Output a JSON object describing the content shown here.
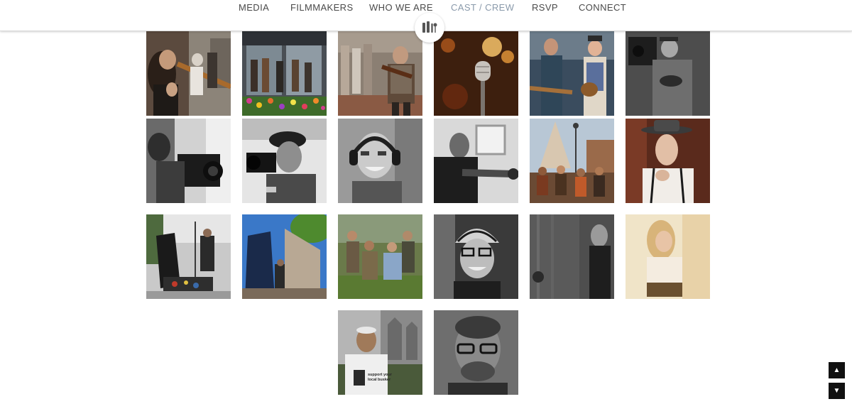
{
  "nav": {
    "items": [
      {
        "label": "MEDIA",
        "active": false
      },
      {
        "label": "FILMMAKERS",
        "active": false
      },
      {
        "label": "WHO WE ARE",
        "active": false
      },
      {
        "label": "CAST / CREW",
        "active": true
      },
      {
        "label": "RSVP",
        "active": false
      },
      {
        "label": "CONNECT",
        "active": false
      }
    ]
  },
  "logo": {
    "icon": "microphone-logo-icon"
  },
  "gallery": {
    "photos": [
      {
        "subject": "didgeridoo player",
        "tone": "color"
      },
      {
        "subject": "storefront band with flowers",
        "tone": "color"
      },
      {
        "subject": "fiddler in crowd",
        "tone": "color"
      },
      {
        "subject": "vintage microphone with bokeh",
        "tone": "color"
      },
      {
        "subject": "two musicians with guitar and mandolin",
        "tone": "color"
      },
      {
        "subject": "cameraman in Batman shirt",
        "tone": "color"
      },
      {
        "subject": "camera operator",
        "tone": "bw"
      },
      {
        "subject": "man with camera in cap",
        "tone": "bw"
      },
      {
        "subject": "smiling man with headphones",
        "tone": "bw"
      },
      {
        "subject": "man with boom mic",
        "tone": "bw"
      },
      {
        "subject": "street band under lamp post",
        "tone": "color"
      },
      {
        "subject": "man in fedora",
        "tone": "color"
      },
      {
        "subject": "street busker with cases",
        "tone": "color"
      },
      {
        "subject": "performer by building",
        "tone": "color"
      },
      {
        "subject": "group on grass",
        "tone": "color"
      },
      {
        "subject": "man in bike helmet",
        "tone": "bw"
      },
      {
        "subject": "woman in dim light",
        "tone": "bw"
      },
      {
        "subject": "woman reading",
        "tone": "color"
      },
      {
        "subject": "man in busker t-shirt",
        "tone": "color"
      },
      {
        "subject": "man with glasses",
        "tone": "bw"
      }
    ],
    "tshirt_text": [
      "support your",
      "local busker"
    ]
  },
  "scroll": {
    "up_icon": "arrow-up-icon",
    "down_icon": "arrow-down-icon",
    "up_glyph": "▲",
    "down_glyph": "▼"
  },
  "colors": {
    "nav_text": "#4a4a4a",
    "nav_active": "#8a9aab",
    "scroll_button": "#111111"
  }
}
